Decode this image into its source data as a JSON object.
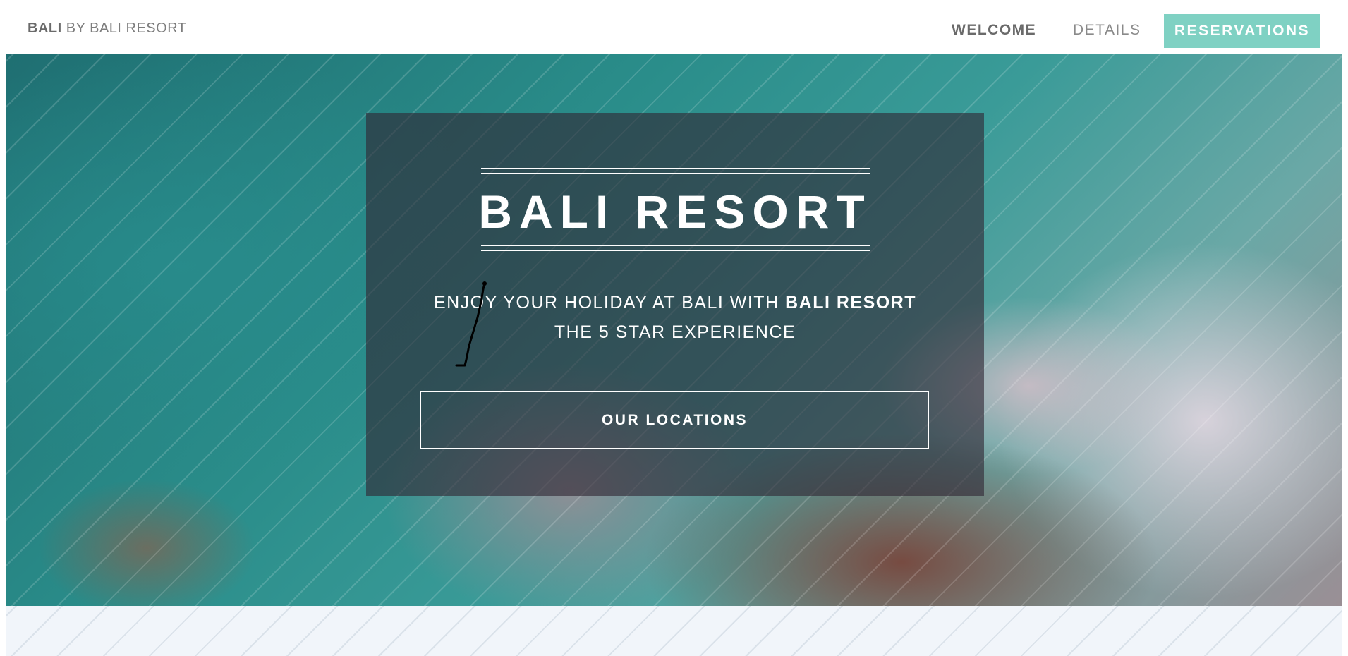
{
  "nav": {
    "brand_strong": "BALI",
    "brand_light": "BY BALI RESORT",
    "links": [
      {
        "label": "WELCOME",
        "active": true
      },
      {
        "label": "DETAILS",
        "active": false
      }
    ],
    "cta_label": "RESERVATIONS"
  },
  "hero": {
    "title": "BALI RESORT",
    "tagline_prefix": "ENJOY YOUR HOLIDAY AT BALI WITH",
    "tagline_brand": "BALI RESORT",
    "tagline_line2": "THE 5 STAR EXPERIENCE",
    "button_label": "OUR LOCATIONS"
  },
  "colors": {
    "accent": "#7fd1c3",
    "nav_text": "#6a6a6a",
    "panel_overlay": "rgba(48,38,52,0.62)",
    "bottom_band": "#f1f5fa"
  }
}
